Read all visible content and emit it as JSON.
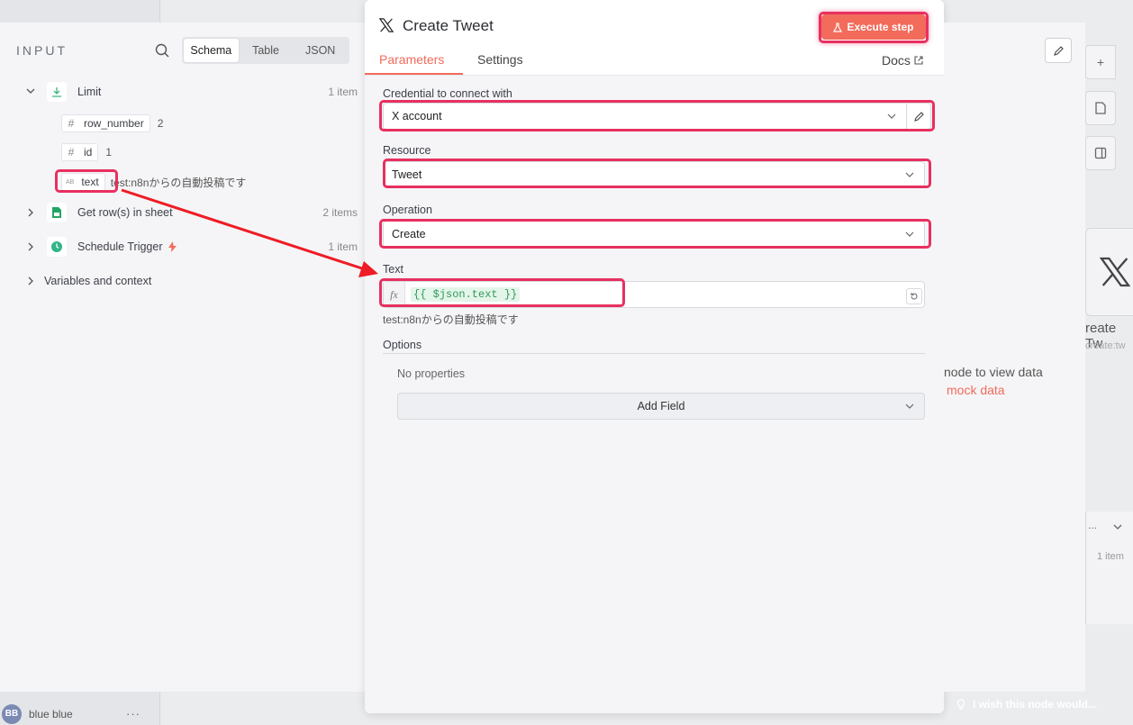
{
  "background": {
    "user_initials": "BB",
    "user_name": "blue blue",
    "user_menu": "···",
    "feedback_label": "I wish this node would..."
  },
  "input_panel": {
    "title": "INPUT",
    "view_tabs": [
      {
        "label": "Schema",
        "active": true
      },
      {
        "label": "Table",
        "active": false
      },
      {
        "label": "JSON",
        "active": false
      }
    ],
    "limit": {
      "name": "Limit",
      "count": "1 item",
      "fields": [
        {
          "type": "#",
          "name": "row_number",
          "value": "2"
        },
        {
          "type": "#",
          "name": "id",
          "value": "1"
        },
        {
          "type": "AB",
          "name": "text",
          "value": "test:n8nからの自動投稿です"
        }
      ]
    },
    "get_rows": {
      "name": "Get row(s) in sheet",
      "count": "2 items"
    },
    "schedule": {
      "name": "Schedule Trigger",
      "count": "1 item"
    },
    "variables": {
      "name": "Variables and context"
    }
  },
  "node": {
    "title": "Create Tweet",
    "execute_label": "Execute step",
    "tabs": {
      "parameters": "Parameters",
      "settings": "Settings"
    },
    "docs_label": "Docs",
    "credential": {
      "label": "Credential to connect with",
      "value": "X account"
    },
    "resource": {
      "label": "Resource",
      "value": "Tweet"
    },
    "operation": {
      "label": "Operation",
      "value": "Create"
    },
    "text": {
      "label": "Text",
      "expression": "{{ $json.text }}",
      "preview": "test:n8nからの自動投稿です"
    },
    "options": {
      "label": "Options",
      "empty": "No properties",
      "add_field": "Add Field"
    }
  },
  "output_panel": {
    "hint_line1": "node to view data",
    "hint_line2": "mock data"
  },
  "canvas": {
    "node_name_partial": "reate Tw",
    "node_sub_partial": "create:tw",
    "panel_count": "1 item",
    "panel_dots": "...",
    "zoom_in": "+"
  },
  "colors": {
    "accent": "#f26b5b",
    "highlight": "#e8305f",
    "expression_green": "#2e9a5a"
  }
}
